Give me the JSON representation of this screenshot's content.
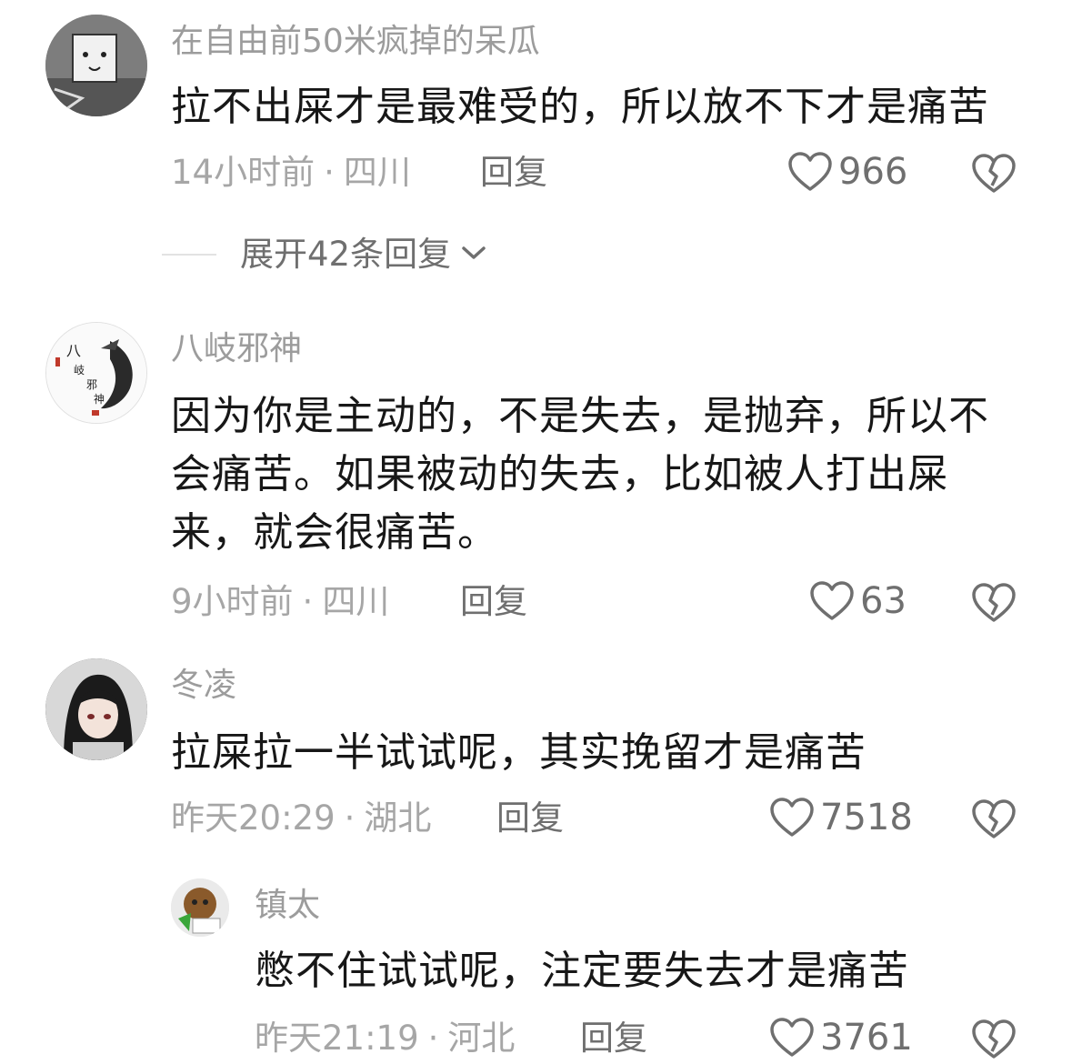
{
  "comments": [
    {
      "username": "在自由前50米疯掉的呆瓜",
      "text": "拉不出屎才是最难受的，所以放不下才是痛苦",
      "time": "14小时前",
      "location": "四川",
      "reply_label": "回复",
      "likes": "966",
      "expand_label": "展开42条回复"
    },
    {
      "username": "八岐邪神",
      "text": "因为你是主动的，不是失去，是抛弃，所以不会痛苦。如果被动的失去，比如被人打出屎来，就会很痛苦。",
      "time": "9小时前",
      "location": "四川",
      "reply_label": "回复",
      "likes": "63",
      "avatar_text": "八岐邪神"
    },
    {
      "username": "冬凌",
      "text": "拉屎拉一半试试呢，其实挽留才是痛苦",
      "time": "昨天20:29",
      "location": "湖北",
      "reply_label": "回复",
      "likes": "7518"
    },
    {
      "username": "镇太",
      "text": "憋不住试试呢，注定要失去才是痛苦",
      "time": "昨天21:19",
      "location": "河北",
      "reply_label": "回复",
      "likes": "3761"
    }
  ],
  "meta_separator": "·",
  "colors": {
    "username": "#9c9c9c",
    "content": "#171717",
    "meta": "#a6a6a6",
    "action": "#6f6f6f"
  }
}
